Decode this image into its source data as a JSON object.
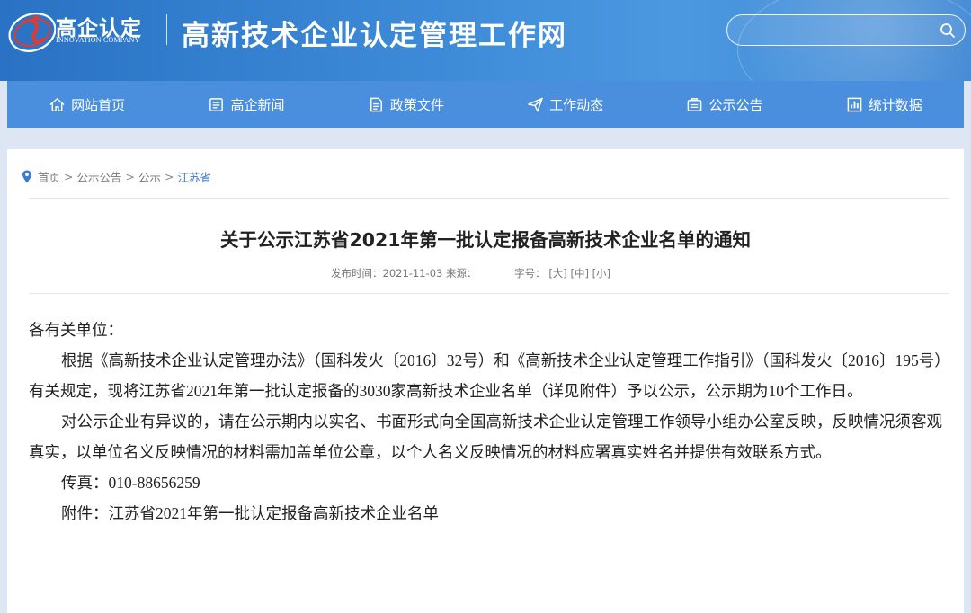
{
  "header": {
    "logo_text": "高企认定",
    "logo_subtext": "INNOVATION COMPANY",
    "site_title": "高新技术企业认定管理工作网",
    "search_placeholder": ""
  },
  "nav": {
    "items": [
      {
        "label": "网站首页",
        "icon": "home-icon"
      },
      {
        "label": "高企新闻",
        "icon": "news-icon"
      },
      {
        "label": "政策文件",
        "icon": "document-icon"
      },
      {
        "label": "工作动态",
        "icon": "send-icon"
      },
      {
        "label": "公示公告",
        "icon": "notice-icon"
      },
      {
        "label": "统计数据",
        "icon": "chart-icon"
      }
    ]
  },
  "breadcrumb": {
    "items": [
      "首页",
      "公示公告",
      "公示",
      "江苏省"
    ],
    "separator": ">"
  },
  "article": {
    "title": "关于公示江苏省2021年第一批认定报备高新技术企业名单的通知",
    "meta": {
      "publish_label": "发布时间：",
      "publish_date": "2021-11-03",
      "source_label": "来源：",
      "font_size_label": "字号：",
      "font_large": "[大]",
      "font_medium": "[中]",
      "font_small": "[小]"
    },
    "greeting": "各有关单位：",
    "paragraphs": [
      "根据《高新技术企业认定管理办法》（国科发火〔2016〕32号）和《高新技术企业认定管理工作指引》（国科发火〔2016〕195号）有关规定，现将江苏省2021年第一批认定报备的3030家高新技术企业名单（详见附件）予以公示，公示期为10个工作日。",
      "对公示企业有异议的，请在公示期内以实名、书面形式向全国高新技术企业认定管理工作领导小组办公室反映，反映情况须客观真实，以单位名义反映情况的材料需加盖单位公章，以个人名义反映情况的材料应署真实姓名并提供有效联系方式。"
    ],
    "fax": "传真：010-88656259",
    "attachment": "附件：江苏省2021年第一批认定报备高新技术企业名单"
  },
  "colors": {
    "header_blue": "#2a72c4",
    "nav_blue": "#4a8fdd",
    "link_blue": "#3a7bd5",
    "page_bg": "#dde6f2"
  }
}
